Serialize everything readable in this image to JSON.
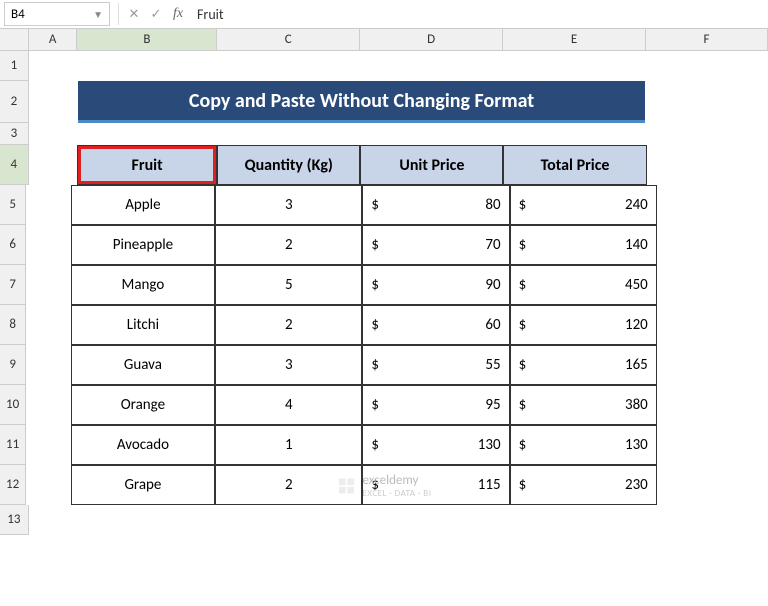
{
  "formulaBar": {
    "nameBox": "B4",
    "formula": "Fruit"
  },
  "columns": [
    "A",
    "B",
    "C",
    "D",
    "E",
    "F"
  ],
  "rowNumbers": [
    "1",
    "2",
    "3",
    "4",
    "5",
    "6",
    "7",
    "8",
    "9",
    "10",
    "11",
    "12",
    "13"
  ],
  "title": "Copy and Paste Without Changing Format",
  "headers": {
    "fruit": "Fruit",
    "qty": "Quantity (Kg)",
    "unit": "Unit Price",
    "total": "Total Price"
  },
  "data": [
    {
      "fruit": "Apple",
      "qty": "3",
      "unit": "80",
      "total": "240"
    },
    {
      "fruit": "Pineapple",
      "qty": "2",
      "unit": "70",
      "total": "140"
    },
    {
      "fruit": "Mango",
      "qty": "5",
      "unit": "90",
      "total": "450"
    },
    {
      "fruit": "Litchi",
      "qty": "2",
      "unit": "60",
      "total": "120"
    },
    {
      "fruit": "Guava",
      "qty": "3",
      "unit": "55",
      "total": "165"
    },
    {
      "fruit": "Orange",
      "qty": "4",
      "unit": "95",
      "total": "380"
    },
    {
      "fruit": "Avocado",
      "qty": "1",
      "unit": "130",
      "total": "130"
    },
    {
      "fruit": "Grape",
      "qty": "2",
      "unit": "115",
      "total": "230"
    }
  ],
  "watermark": {
    "brand": "exceldemy",
    "sub": "EXCEL · DATA · BI"
  },
  "currency": "$"
}
